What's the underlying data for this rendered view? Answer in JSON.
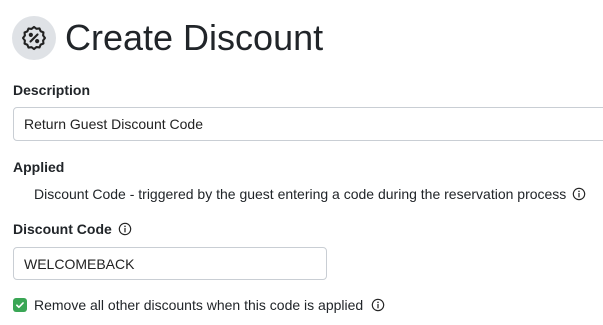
{
  "header": {
    "icon": "percent-badge-icon",
    "title": "Create Discount"
  },
  "description": {
    "label": "Description",
    "value": "Return Guest Discount Code"
  },
  "applied": {
    "label": "Applied",
    "text": "Discount Code - triggered by the guest entering a code during the reservation process",
    "icon": "info-icon"
  },
  "discount_code": {
    "label": "Discount Code",
    "icon": "info-icon",
    "value": "WELCOMEBACK"
  },
  "remove_others": {
    "checked": true,
    "label": "Remove all other discounts when this code is applied",
    "icon": "info-icon"
  },
  "colors": {
    "badge_bg": "#dfe2e6",
    "checkbox_green": "#3aa655",
    "input_border": "#c9ced4"
  }
}
